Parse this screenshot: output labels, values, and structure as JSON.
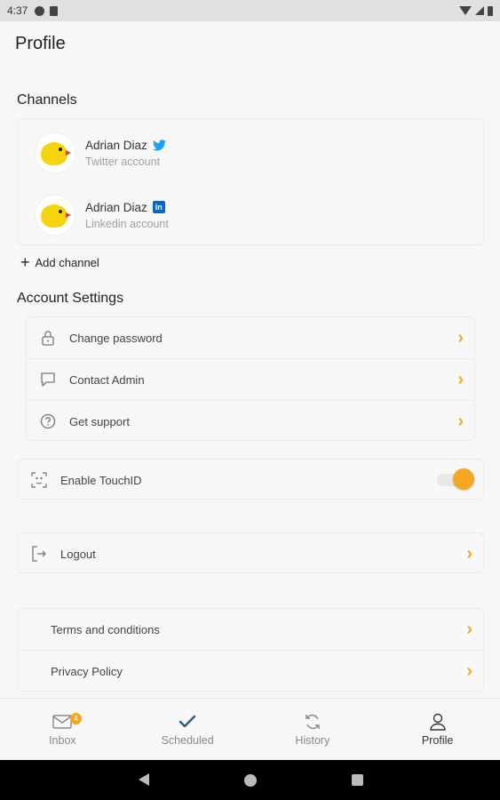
{
  "status_bar": {
    "time": "4:37"
  },
  "page": {
    "title": "Profile"
  },
  "channels": {
    "section_title": "Channels",
    "items": [
      {
        "name": "Adrian Diaz",
        "account": "Twitter account",
        "network_icon": "twitter-icon"
      },
      {
        "name": "Adrian Diaz",
        "account": "Linkedin account",
        "network_icon": "linkedin-icon",
        "icon_text": "in"
      }
    ],
    "add_label": "Add channel"
  },
  "account_settings": {
    "section_title": "Account Settings",
    "items": [
      {
        "label": "Change password",
        "icon": "lock-icon"
      },
      {
        "label": "Contact Admin",
        "icon": "chat-icon"
      },
      {
        "label": "Get support",
        "icon": "help-icon"
      }
    ]
  },
  "touch_id": {
    "label": "Enable TouchID",
    "enabled": true
  },
  "logout": {
    "label": "Logout"
  },
  "legal": [
    {
      "label": "Terms and conditions"
    },
    {
      "label": "Privacy Policy"
    }
  ],
  "bottom_nav": [
    {
      "label": "Inbox",
      "icon": "inbox-icon",
      "badge": "4",
      "active": false
    },
    {
      "label": "Scheduled",
      "icon": "check-icon",
      "active": false
    },
    {
      "label": "History",
      "icon": "refresh-icon",
      "active": false
    },
    {
      "label": "Profile",
      "icon": "user-icon",
      "active": true
    }
  ],
  "colors": {
    "accent": "#f5a623",
    "twitter": "#1da1f2",
    "linkedin": "#0a66c2"
  }
}
